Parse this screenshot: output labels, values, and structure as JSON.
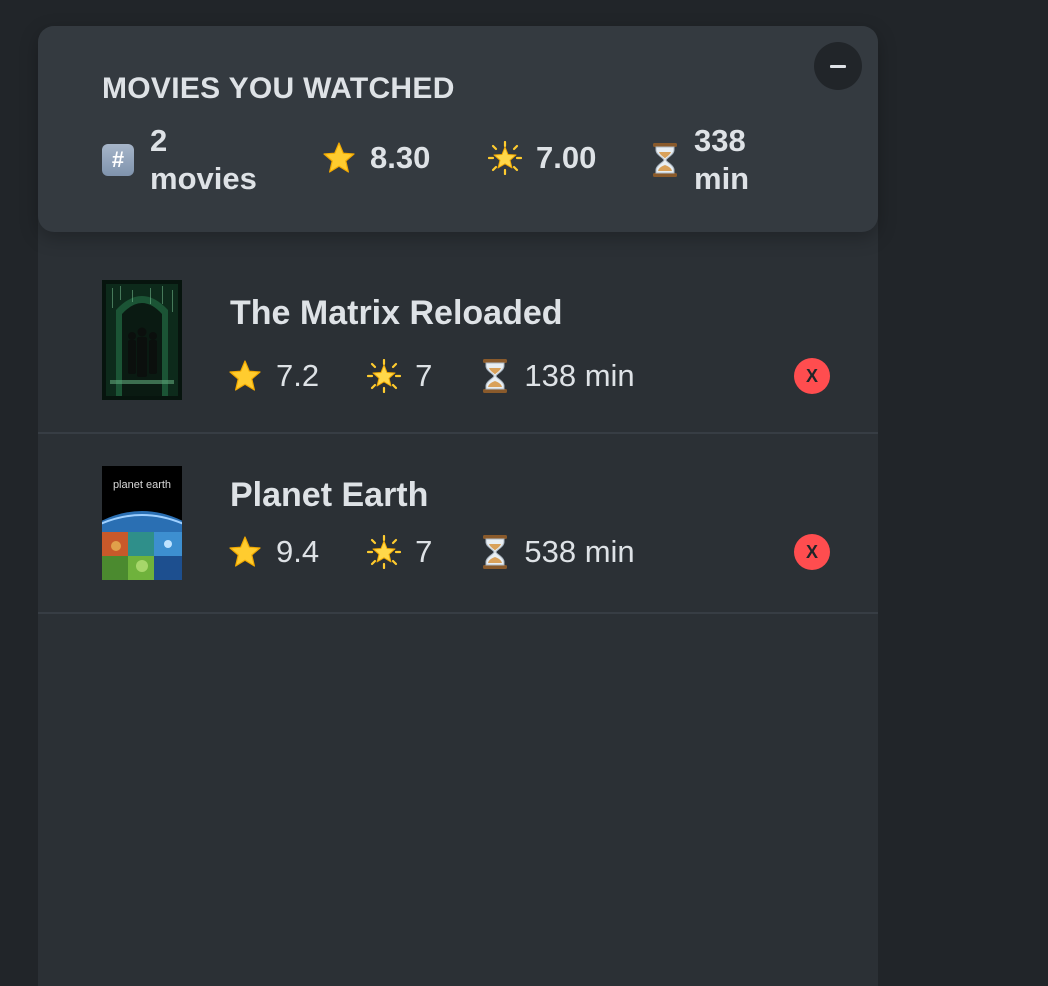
{
  "summary": {
    "title": "MOVIES YOU WATCHED",
    "collapse_label": "−",
    "count_line1": "2",
    "count_line2": "movies",
    "avg_imdb": "8.30",
    "avg_user": "7.00",
    "runtime_line1": "338",
    "runtime_line2": "min",
    "icons": {
      "count": "hash-keycap-icon",
      "imdb": "star-icon",
      "user": "glowing-star-icon",
      "runtime": "hourglass-icon"
    }
  },
  "movies": [
    {
      "title": "The Matrix Reloaded",
      "imdb_rating": "7.2",
      "user_rating": "7",
      "runtime": "138 min",
      "remove_label": "X",
      "poster": "matrix-reloaded-poster"
    },
    {
      "title": "Planet Earth",
      "imdb_rating": "9.4",
      "user_rating": "7",
      "runtime": "538 min",
      "remove_label": "X",
      "poster": "planet-earth-poster",
      "poster_text": "planet earth"
    }
  ],
  "colors": {
    "background": "#212529",
    "panel": "#2b3035",
    "summary": "#343a40",
    "text": "#dee2e6",
    "remove": "#ff4d4f"
  }
}
